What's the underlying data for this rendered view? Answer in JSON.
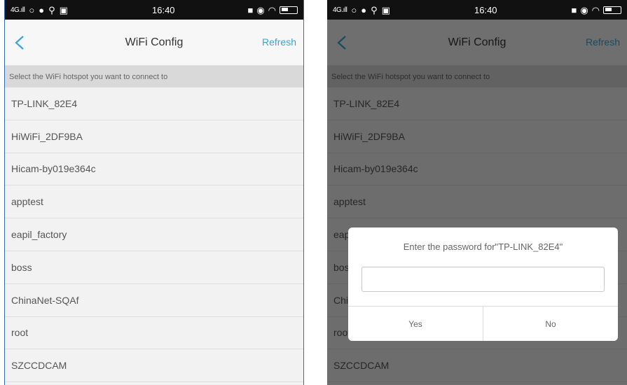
{
  "status_bar": {
    "signal": "4G.ıll",
    "time": "16:40",
    "icons_left": [
      "circle-icon",
      "chat-icon",
      "usb-icon",
      "image-icon"
    ],
    "icons_right": [
      "sim-icon",
      "alarm-icon",
      "wifi-icon",
      "battery-icon"
    ]
  },
  "nav": {
    "title": "WiFi Config",
    "refresh_label": "Refresh",
    "back_icon": "chevron-left-icon",
    "accent_color": "#3aa4d8"
  },
  "hint": "Select the WiFi hotspot you want to connect to",
  "networks": [
    "TP-LINK_82E4",
    "HiWiFi_2DF9BA",
    "Hicam-by019e364c",
    "apptest",
    "eapil_factory",
    "boss",
    "ChinaNet-SQAf",
    "root",
    "SZCCDCAM"
  ],
  "dialog": {
    "title": "Enter the password for\"TP-LINK_82E4\"",
    "password_value": "",
    "yes_label": "Yes",
    "no_label": "No"
  }
}
